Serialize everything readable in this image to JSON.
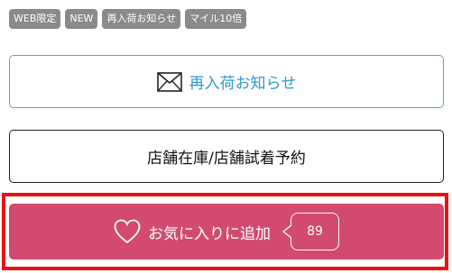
{
  "tags": [
    "WEB限定",
    "NEW",
    "再入荷お知らせ",
    "マイル10倍"
  ],
  "restock_button": {
    "label": "再入荷お知らせ",
    "icon": "mail-icon"
  },
  "store_button": {
    "label": "店舗在庫/店舗試着予約"
  },
  "favorite_button": {
    "label": "お気に入りに追加",
    "icon": "heart-icon",
    "count": "89"
  },
  "colors": {
    "tag_bg": "#8a8a8a",
    "restock_accent": "#2b9ad0",
    "favorite_bg": "#d24a6f",
    "highlight_frame": "#ee1111"
  }
}
